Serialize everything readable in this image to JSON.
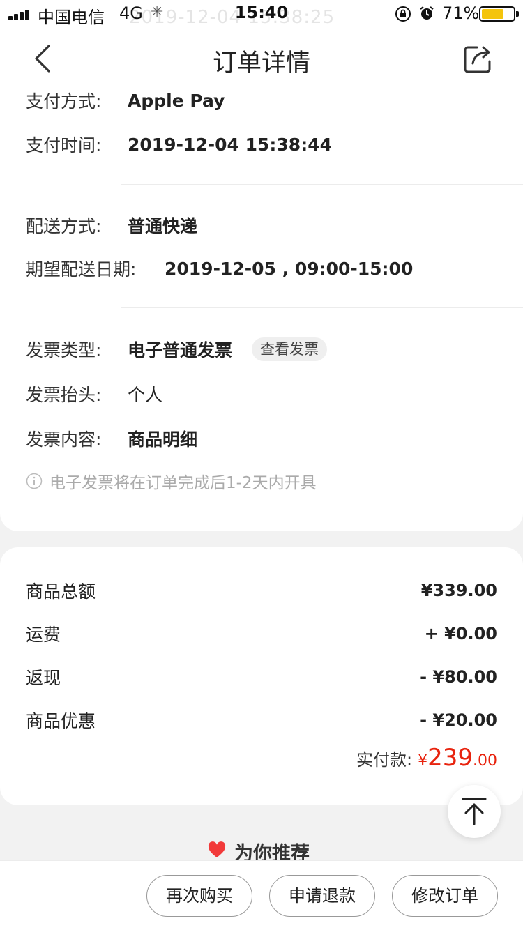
{
  "status_bar": {
    "carrier": "中国电信",
    "network": "4G",
    "time": "15:40",
    "battery_percent": "71%",
    "battery_level": 0.71,
    "ghost_text": "2019-12-04 15:38:25"
  },
  "nav": {
    "title": "订单详情",
    "back_icon": "chevron-left-icon",
    "share_icon": "share-icon"
  },
  "payment": {
    "method_label": "支付方式:",
    "method_value": "Apple Pay",
    "time_label": "支付时间:",
    "time_value": "2019-12-04 15:38:44"
  },
  "delivery": {
    "method_label": "配送方式:",
    "method_value": "普通快递",
    "date_label": "期望配送日期:",
    "date_value": "2019-12-05 , 09:00-15:00"
  },
  "invoice": {
    "type_label": "发票类型:",
    "type_value": "电子普通发票",
    "view_button": "查看发票",
    "title_label": "发票抬头:",
    "title_value": "个人",
    "content_label": "发票内容:",
    "content_value": "商品明细",
    "notice": "电子发票将在订单完成后1-2天内开具"
  },
  "amounts": {
    "subtotal_label": "商品总额",
    "subtotal_value": "¥339.00",
    "shipping_label": "运费",
    "shipping_value": "+ ¥0.00",
    "cashback_label": "返现",
    "cashback_value": "- ¥80.00",
    "discount_label": "商品优惠",
    "discount_value": "- ¥20.00",
    "total_label": "实付款:",
    "total_currency": "¥",
    "total_integer": "239",
    "total_decimal": ".00"
  },
  "colors": {
    "accent_red": "#e8230e",
    "battery_yellow": "#f4c40c"
  },
  "recommend": {
    "title": "为你推荐",
    "icon": "heart-icon"
  },
  "back_to_top_icon": "arrow-up-to-top-icon",
  "actions": {
    "buy_again": "再次购买",
    "refund": "申请退款",
    "modify_order": "修改订单"
  }
}
